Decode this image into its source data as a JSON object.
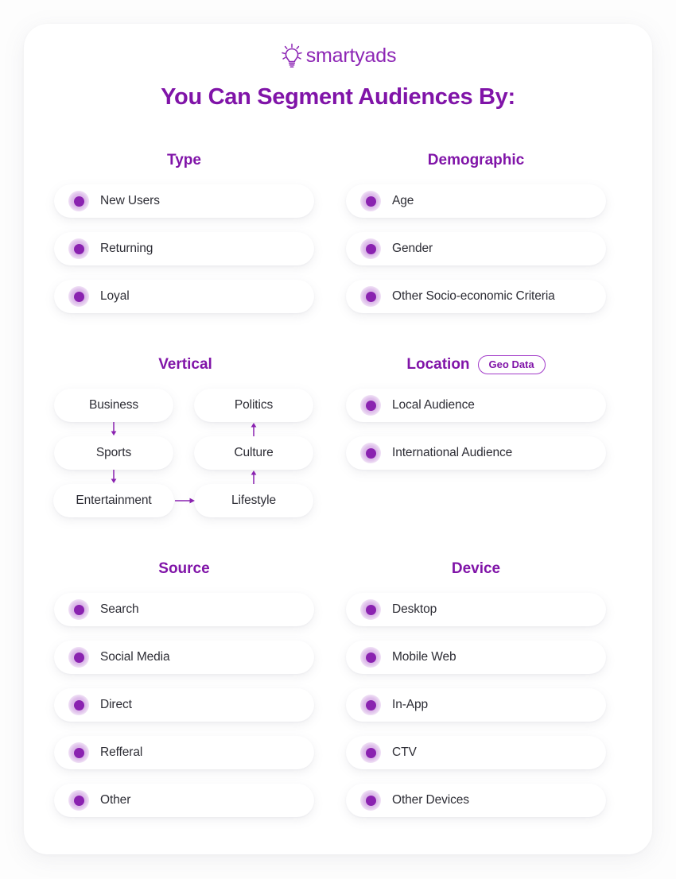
{
  "brand": {
    "name": "smartyads",
    "icon": "lightbulb-icon",
    "color": "#8d26b5"
  },
  "title": "You Can Segment Audiences By:",
  "theme": {
    "accent": "#8014a8",
    "bullet": "#8a22b0",
    "text": "#2d2d35",
    "card_bg": "#ffffff",
    "page_bg": "#fdfdfd"
  },
  "sections": {
    "type": {
      "heading": "Type",
      "items": [
        {
          "label": "New Users"
        },
        {
          "label": "Returning"
        },
        {
          "label": "Loyal"
        }
      ]
    },
    "demographic": {
      "heading": "Demographic",
      "items": [
        {
          "label": "Age"
        },
        {
          "label": "Gender"
        },
        {
          "label": "Other Socio-economic Criteria"
        }
      ]
    },
    "vertical": {
      "heading": "Vertical",
      "nodes": [
        {
          "label": "Business"
        },
        {
          "label": "Politics"
        },
        {
          "label": "Sports"
        },
        {
          "label": "Culture"
        },
        {
          "label": "Entertainment"
        },
        {
          "label": "Lifestyle"
        }
      ],
      "flow": [
        {
          "from": "Business",
          "to": "Sports",
          "direction": "down"
        },
        {
          "from": "Sports",
          "to": "Entertainment",
          "direction": "down"
        },
        {
          "from": "Entertainment",
          "to": "Lifestyle",
          "direction": "right"
        },
        {
          "from": "Lifestyle",
          "to": "Culture",
          "direction": "up"
        },
        {
          "from": "Culture",
          "to": "Politics",
          "direction": "up"
        }
      ]
    },
    "location": {
      "heading": "Location",
      "badge": "Geo Data",
      "items": [
        {
          "label": "Local Audience"
        },
        {
          "label": "International Audience"
        }
      ]
    },
    "source": {
      "heading": "Source",
      "items": [
        {
          "label": "Search"
        },
        {
          "label": "Social Media"
        },
        {
          "label": "Direct"
        },
        {
          "label": "Refferal"
        },
        {
          "label": "Other"
        }
      ]
    },
    "device": {
      "heading": "Device",
      "items": [
        {
          "label": "Desktop"
        },
        {
          "label": "Mobile Web"
        },
        {
          "label": "In-App"
        },
        {
          "label": "CTV"
        },
        {
          "label": "Other Devices"
        }
      ]
    }
  }
}
